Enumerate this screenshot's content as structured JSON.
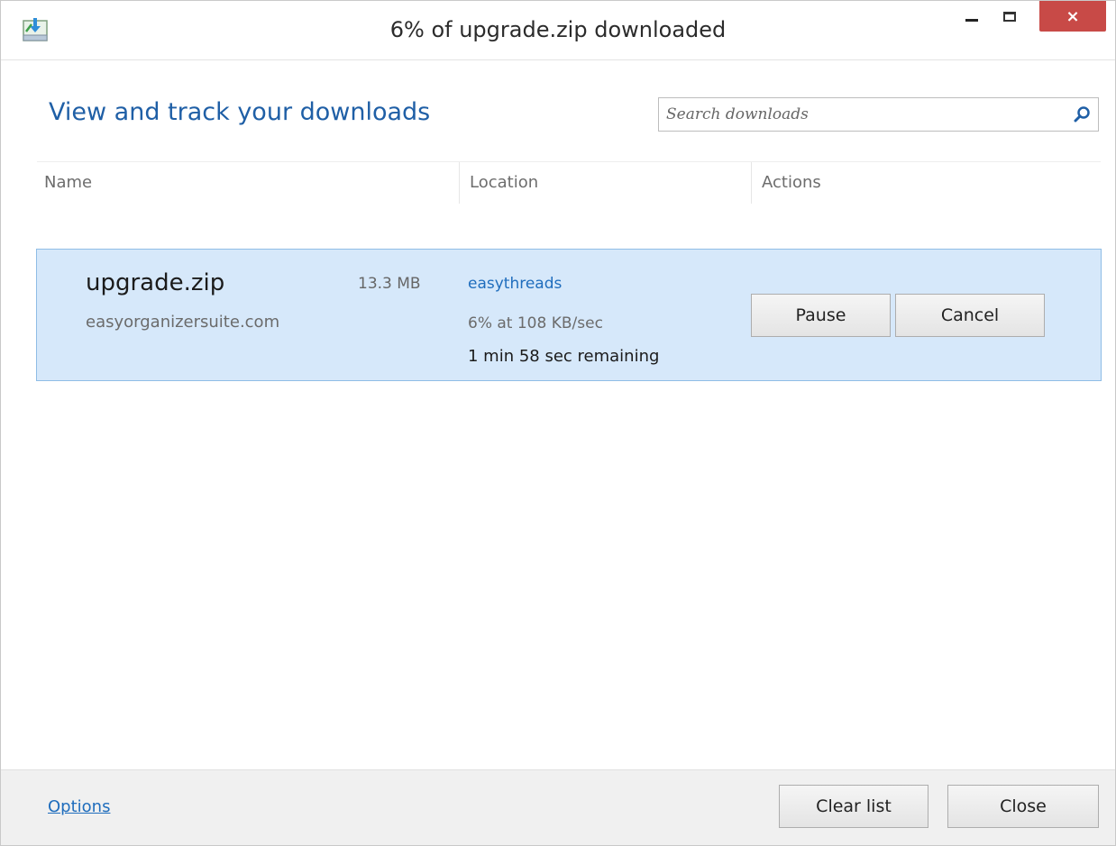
{
  "window": {
    "title": "6% of upgrade.zip downloaded",
    "close_glyph": "×"
  },
  "header": {
    "title": "View and track your downloads",
    "search_placeholder": "Search downloads"
  },
  "columns": {
    "name": "Name",
    "location": "Location",
    "actions": "Actions"
  },
  "download": {
    "file_name": "upgrade.zip",
    "size": "13.3 MB",
    "source": "easyorganizersuite.com",
    "location": "easythreads",
    "progress": "6% at 108 KB/sec",
    "remaining": "1 min 58 sec remaining",
    "pause_label": "Pause",
    "cancel_label": "Cancel"
  },
  "footer": {
    "options_label": "Options",
    "clear_list_label": "Clear list",
    "close_label": "Close"
  },
  "colors": {
    "accent_title": "#1f5fa6",
    "link": "#1f6dbd",
    "selected_row": "#d6e8fa",
    "close_button": "#c84a47"
  },
  "icons": [
    "download-manager-icon",
    "minimize-icon",
    "maximize-icon",
    "close-icon",
    "search-icon"
  ]
}
